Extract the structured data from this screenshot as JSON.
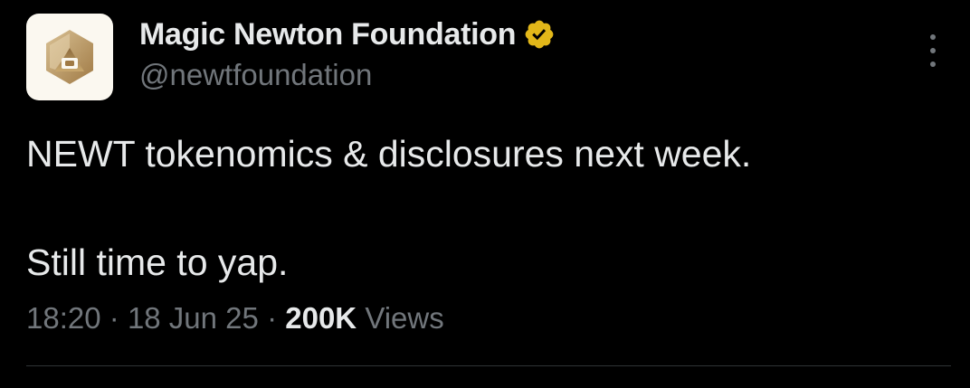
{
  "author": {
    "display_name": "Magic Newton Foundation",
    "handle": "@newtfoundation",
    "verified": true,
    "verified_badge_color": "#e2b719",
    "avatar_icon": "magic-newton-logo-icon"
  },
  "tweet": {
    "line1": "NEWT tokenomics & disclosures next week.",
    "line2": "Still time to yap."
  },
  "meta": {
    "time": "18:20",
    "separator": "·",
    "date": "18 Jun 25",
    "views_count": "200K",
    "views_label": "Views"
  },
  "colors": {
    "background": "#000000",
    "primary_text": "#e7e9ea",
    "secondary_text": "#71767b",
    "divider": "#2f3336"
  },
  "icons": {
    "more": "more-options-icon",
    "verified": "verified-badge-icon"
  }
}
